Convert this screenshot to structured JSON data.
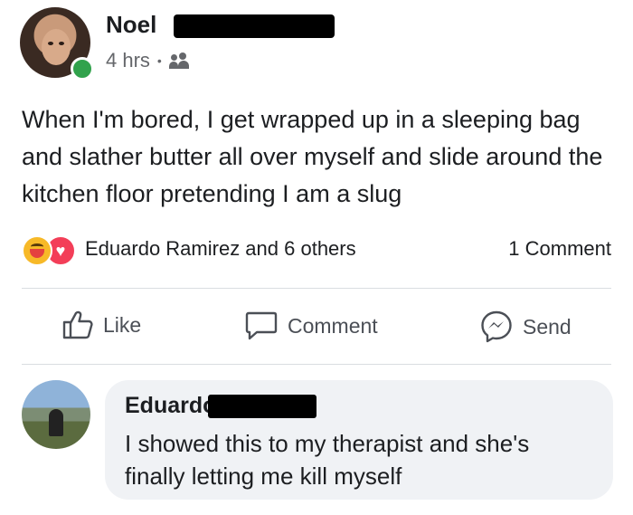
{
  "post": {
    "author": "Noel",
    "time": "4 hrs",
    "separator": "•",
    "audience_icon": "friends-icon",
    "text": "When I'm bored, I get wrapped up in a sleeping bag and slather butter all over myself and slide around the kitchen floor pretending I am a slug"
  },
  "reactions": {
    "icons": [
      "haha-reaction-icon",
      "love-reaction-icon"
    ],
    "names": "Eduardo Ramirez and 6 others",
    "comment_count": "1 Comment"
  },
  "actions": {
    "like": "Like",
    "comment": "Comment",
    "send": "Send"
  },
  "comment": {
    "author": "Eduardo",
    "text": "I showed this to my therapist and she's finally letting me kill myself"
  },
  "colors": {
    "online": "#31a24c",
    "haha": "#f7b928",
    "love": "#f33e58",
    "bubble": "#f0f2f5",
    "secondary_text": "#65676b"
  }
}
